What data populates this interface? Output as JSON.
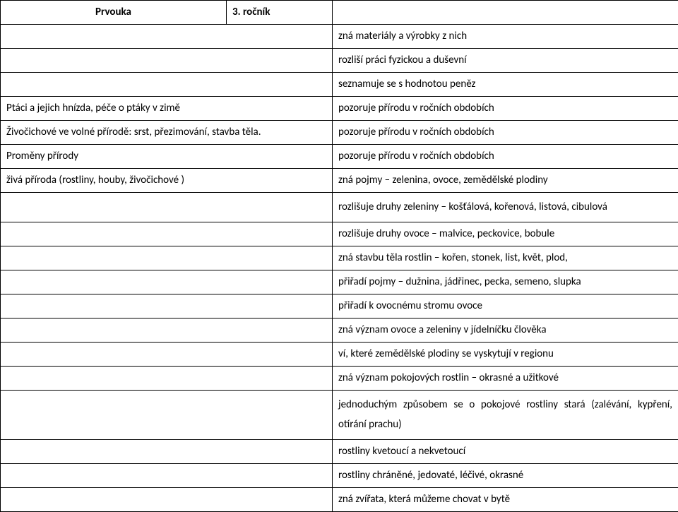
{
  "header": {
    "subject": "Prvouka",
    "grade": "3. ročník",
    "right": ""
  },
  "rows": [
    {
      "left": "",
      "right": "zná materiály a výrobky z nich",
      "left_colspan": 2
    },
    {
      "left": "",
      "right": "rozliší práci fyzickou a duševní",
      "left_colspan": 2
    },
    {
      "left": "",
      "right": "seznamuje se s hodnotou peněz",
      "left_colspan": 2
    },
    {
      "left": "Ptáci a jejich hnízda, péče o ptáky v zimě",
      "right": "pozoruje přírodu v ročních obdobích",
      "left_colspan": 2
    },
    {
      "left": "Živočichové ve volné přírodě: srst, přezimování, stavba těla.",
      "right": "pozoruje přírodu v ročních obdobích",
      "left_colspan": 2
    },
    {
      "left": "Proměny přírody",
      "right": "pozoruje přírodu v ročních obdobích",
      "left_colspan": 2
    },
    {
      "left": "živá příroda (rostliny, houby, živočichové )",
      "right": "zná pojmy – zelenina, ovoce, zemědělské plodiny",
      "left_colspan": 2
    },
    {
      "left": "",
      "right": "rozlišuje druhy zeleniny – košťálová, kořenová, listová, cibulová",
      "left_colspan": 2,
      "wrap": true,
      "justify": true
    },
    {
      "left": "",
      "right": "rozlišuje druhy ovoce – malvice, peckovice, bobule",
      "left_colspan": 2
    },
    {
      "left": "",
      "right": "zná stavbu těla rostlin – kořen, stonek, list, květ, plod,",
      "left_colspan": 2
    },
    {
      "left": "",
      "right": "přiřadí pojmy – dužnina, jádřinec, pecka, semeno, slupka",
      "left_colspan": 2
    },
    {
      "left": "",
      "right": "přiřadí k ovocnému stromu ovoce",
      "left_colspan": 2
    },
    {
      "left": "",
      "right": "zná význam ovoce a zeleniny v jídelníčku člověka",
      "left_colspan": 2
    },
    {
      "left": "",
      "right": "ví, které zemědělské plodiny se vyskytují v regionu",
      "left_colspan": 2
    },
    {
      "left": "",
      "right": "zná význam pokojových rostlin – okrasné a užitkové",
      "left_colspan": 2
    },
    {
      "left": "",
      "right": "jednoduchým způsobem se o pokojové rostliny stará (zalévání, kypření, otírání prachu)",
      "left_colspan": 2,
      "wrap": true,
      "justify": true
    },
    {
      "left": "",
      "right": "rostliny kvetoucí a nekvetoucí",
      "left_colspan": 2
    },
    {
      "left": "",
      "right": "rostliny chráněné, jedovaté, léčivé, okrasné",
      "left_colspan": 2
    },
    {
      "left": "",
      "right": "zná zvířata, která můžeme chovat v bytě",
      "left_colspan": 2
    }
  ]
}
